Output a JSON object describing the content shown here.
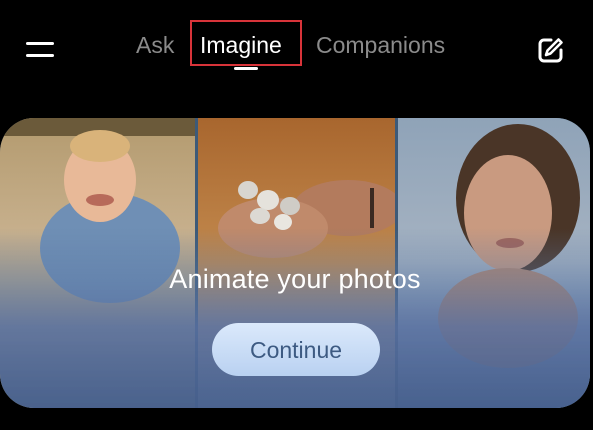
{
  "header": {
    "menu_icon": "hamburger-menu-icon",
    "compose_icon": "edit-pencil-icon",
    "tabs": [
      {
        "label": "Ask",
        "active": false
      },
      {
        "label": "Imagine",
        "active": true
      },
      {
        "label": "Companions",
        "active": false
      }
    ],
    "colors": {
      "active_tab": "#ffffff",
      "inactive_tab": "#8b8b8b",
      "highlight": "#d9343a"
    }
  },
  "promo": {
    "headline": "Animate your photos",
    "button_label": "Continue",
    "colors": {
      "button_bg": "#c8dcf6",
      "button_text": "#3d5a82",
      "overlay": "#5a78a5"
    }
  }
}
